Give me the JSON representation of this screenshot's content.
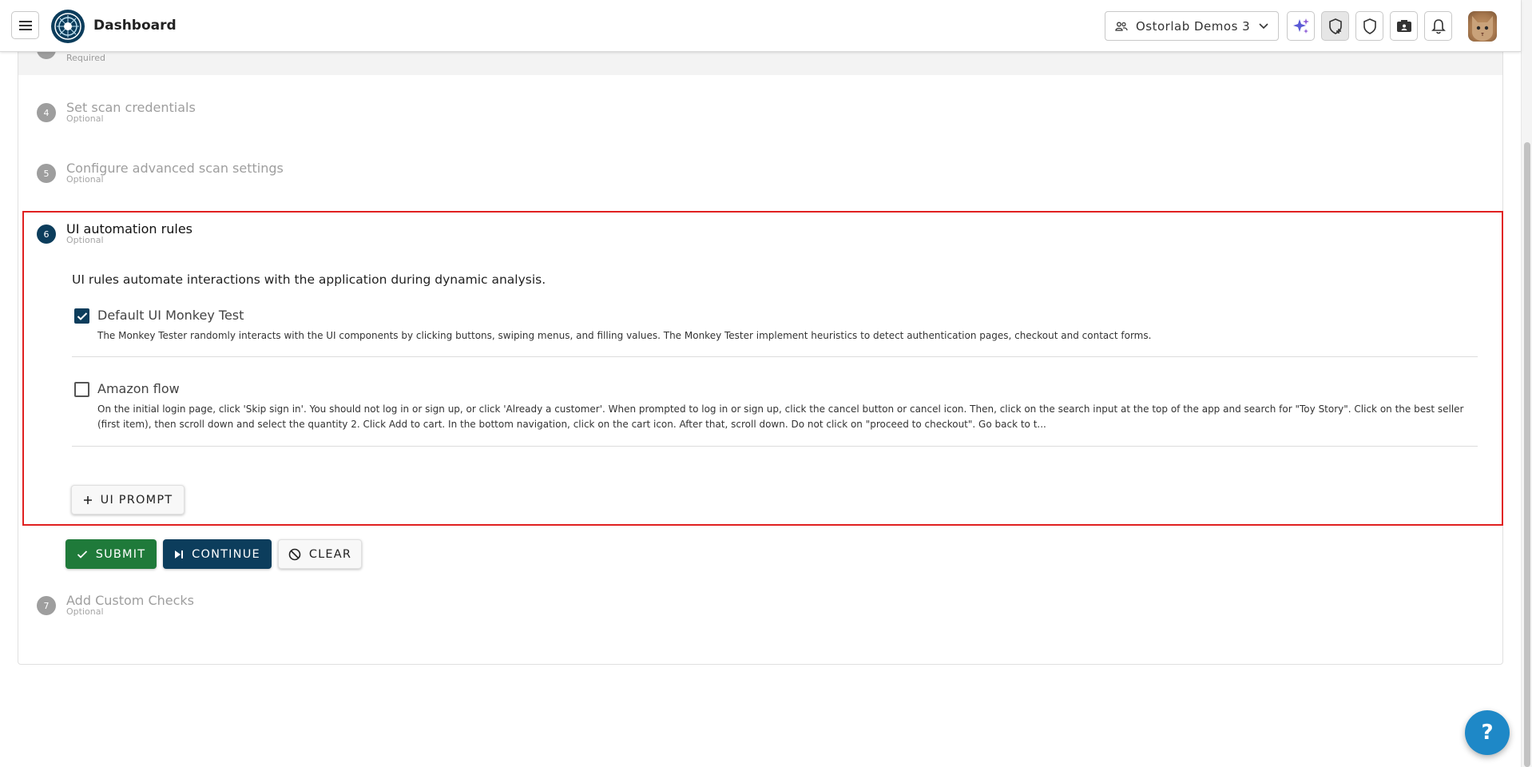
{
  "header": {
    "app_title": "Dashboard",
    "org_name": "Ostorlab Demos 3",
    "icons": [
      "menu-icon",
      "logo-icon",
      "sparkle-icon",
      "shield-add-icon",
      "shield-icon",
      "id-card-icon",
      "bell-icon"
    ]
  },
  "steps": {
    "prev_sub": "Required",
    "step4": {
      "number": "4",
      "title": "Set scan credentials",
      "sub": "Optional"
    },
    "step5": {
      "number": "5",
      "title": "Configure advanced scan settings",
      "sub": "Optional"
    },
    "step6": {
      "number": "6",
      "title": "UI automation rules",
      "sub": "Optional"
    },
    "step7": {
      "number": "7",
      "title": "Add Custom Checks",
      "sub": "Optional"
    }
  },
  "ui_rules": {
    "description": "UI rules automate interactions with the application during dynamic analysis.",
    "rules": [
      {
        "title": "Default UI Monkey Test",
        "checked": true,
        "text": "The Monkey Tester randomly interacts with the UI components by clicking buttons, swiping menus, and filling values. The Monkey Tester implement heuristics to detect authentication pages, checkout and contact forms."
      },
      {
        "title": "Amazon flow",
        "checked": false,
        "text": "On the initial login page, click 'Skip sign in'. You should not log in or sign up, or click 'Already a customer'. When prompted to log in or sign up, click the cancel button or cancel icon. Then, click on the search input at the top of the app and search for \"Toy Story\". Click on the best seller (first item), then scroll down and select the quantity 2. Click Add to cart. In the bottom navigation, click on the cart icon. After that, scroll down. Do not click on \"proceed to checkout\". Go back to t..."
      }
    ],
    "add_prompt_label": "UI PROMPT"
  },
  "actions": {
    "submit_label": "SUBMIT",
    "continue_label": "CONTINUE",
    "clear_label": "CLEAR"
  },
  "help": {
    "label": "?"
  },
  "colors": {
    "primary": "#0c3d5c",
    "success": "#1f7a3a",
    "highlight": "#e02020",
    "help": "#1e88c7"
  }
}
